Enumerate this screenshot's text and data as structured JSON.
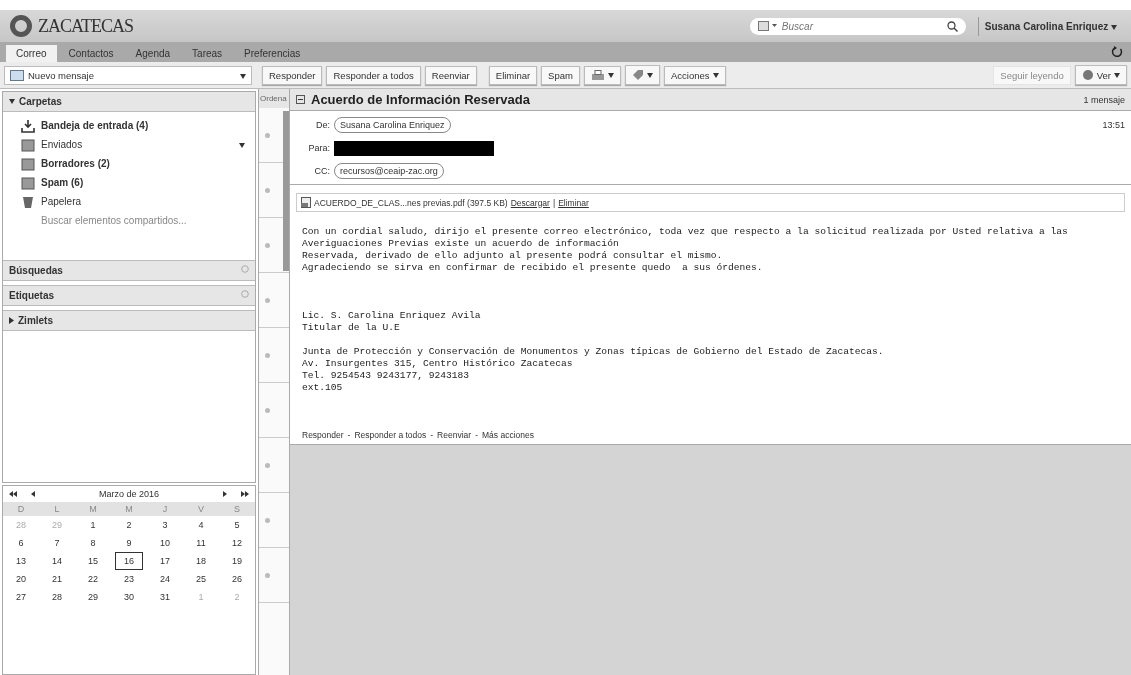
{
  "header": {
    "logo": "ZACATECAS",
    "search": {
      "placeholder": "Buscar"
    },
    "user": "Susana Carolina Enriquez"
  },
  "tabs": [
    {
      "label": "Correo",
      "selected": true
    },
    {
      "label": "Contactos",
      "selected": false
    },
    {
      "label": "Agenda",
      "selected": false
    },
    {
      "label": "Tareas",
      "selected": false
    },
    {
      "label": "Preferencias",
      "selected": false
    }
  ],
  "new_message": "Nuevo mensaje",
  "toolbar": {
    "buttons": [
      {
        "kind": "text",
        "label": "Responder"
      },
      {
        "kind": "text",
        "label": "Responder a todos"
      },
      {
        "kind": "text",
        "label": "Reenviar"
      },
      {
        "kind": "gap"
      },
      {
        "kind": "text",
        "label": "Eliminar"
      },
      {
        "kind": "text",
        "label": "Spam"
      },
      {
        "kind": "print"
      },
      {
        "kind": "tag"
      },
      {
        "kind": "menu",
        "label": "Acciones"
      }
    ],
    "continue": "Seguir leyendo",
    "view": "Ver"
  },
  "sidebar": {
    "folders_title": "Carpetas",
    "folders": [
      {
        "kind": "inbox",
        "label": "Bandeja de entrada (4)",
        "bold": true
      },
      {
        "kind": "sent",
        "label": "Enviados",
        "bold": false
      },
      {
        "kind": "drafts",
        "label": "Borradores (2)",
        "bold": true
      },
      {
        "kind": "spam",
        "label": "Spam (6)",
        "bold": true
      },
      {
        "kind": "trash",
        "label": "Papelera",
        "bold": false
      }
    ],
    "shared_search": "Buscar elementos compartidos...",
    "sections": [
      {
        "label": "Búsquedas",
        "expanded": false
      },
      {
        "label": "Etiquetas",
        "expanded": false
      }
    ],
    "zimlets": {
      "label": "Zimlets",
      "expanded": false
    }
  },
  "calendar": {
    "title": "Marzo de 2016",
    "weekdays": [
      "D",
      "L",
      "M",
      "M",
      "J",
      "V",
      "S"
    ],
    "days": [
      {
        "n": "28",
        "muted": true,
        "selected": false
      },
      {
        "n": "29",
        "muted": true,
        "selected": false
      },
      {
        "n": "1",
        "muted": false,
        "selected": false
      },
      {
        "n": "2",
        "muted": false,
        "selected": false
      },
      {
        "n": "3",
        "muted": false,
        "selected": false
      },
      {
        "n": "4",
        "muted": false,
        "selected": false
      },
      {
        "n": "5",
        "muted": false,
        "selected": false
      },
      {
        "n": "6",
        "muted": false,
        "selected": false
      },
      {
        "n": "7",
        "muted": false,
        "selected": false
      },
      {
        "n": "8",
        "muted": false,
        "selected": false
      },
      {
        "n": "9",
        "muted": false,
        "selected": false
      },
      {
        "n": "10",
        "muted": false,
        "selected": false
      },
      {
        "n": "11",
        "muted": false,
        "selected": false
      },
      {
        "n": "12",
        "muted": false,
        "selected": false
      },
      {
        "n": "13",
        "muted": false,
        "selected": false
      },
      {
        "n": "14",
        "muted": false,
        "selected": false
      },
      {
        "n": "15",
        "muted": false,
        "selected": false
      },
      {
        "n": "16",
        "muted": false,
        "selected": true
      },
      {
        "n": "17",
        "muted": false,
        "selected": false
      },
      {
        "n": "18",
        "muted": false,
        "selected": false
      },
      {
        "n": "19",
        "muted": false,
        "selected": false
      },
      {
        "n": "20",
        "muted": false,
        "selected": false
      },
      {
        "n": "21",
        "muted": false,
        "selected": false
      },
      {
        "n": "22",
        "muted": false,
        "selected": false
      },
      {
        "n": "23",
        "muted": false,
        "selected": false
      },
      {
        "n": "24",
        "muted": false,
        "selected": false
      },
      {
        "n": "25",
        "muted": false,
        "selected": false
      },
      {
        "n": "26",
        "muted": false,
        "selected": false
      },
      {
        "n": "27",
        "muted": false,
        "selected": false
      },
      {
        "n": "28",
        "muted": false,
        "selected": false
      },
      {
        "n": "29",
        "muted": false,
        "selected": false
      },
      {
        "n": "30",
        "muted": false,
        "selected": false
      },
      {
        "n": "31",
        "muted": false,
        "selected": false
      },
      {
        "n": "1",
        "muted": true,
        "selected": false
      },
      {
        "n": "2",
        "muted": true,
        "selected": false
      }
    ]
  },
  "message_list": {
    "header": "Ordena"
  },
  "message": {
    "subject": "Acuerdo de Información Reservada",
    "count": "1 mensaje",
    "time": "13:51",
    "from_label": "De:",
    "from": "Susana Carolina Enriquez",
    "to_label": "Para:",
    "cc_label": "CC:",
    "cc": "recursos@ceaip-zac.org",
    "attachment": {
      "name": "ACUERDO_DE_CLAS...nes previas.pdf (397.5 KB)",
      "download": "Descargar",
      "separator": "|",
      "delete": "Eliminar"
    },
    "body": [
      [
        "Con un cordial saludo, dirijo el presente correo electrónico, toda vez que respecto a la solicitud realizada por Usted relativa a las",
        "Averiguaciones Previas existe un acuerdo de información",
        "Reservada, derivado de ello adjunto al presente podrá consultar el mismo.",
        "Agradeciendo se sirva en confirmar de recibido el presente quedo  a sus órdenes."
      ],
      [
        "Lic. S. Carolina Enriquez Avila",
        "Titular de la U.E"
      ],
      [
        "Junta de Protección y Conservación de Monumentos y Zonas típicas de Gobierno del Estado de Zacatecas.",
        "Av. Insurgentes 315, Centro Histórico Zacatecas",
        "Tel. 9254543 9243177, 9243183",
        "ext.105"
      ]
    ],
    "actions": [
      "Responder",
      "Responder a todos",
      "Reenviar",
      "Más acciones"
    ],
    "action_separator": "-"
  }
}
